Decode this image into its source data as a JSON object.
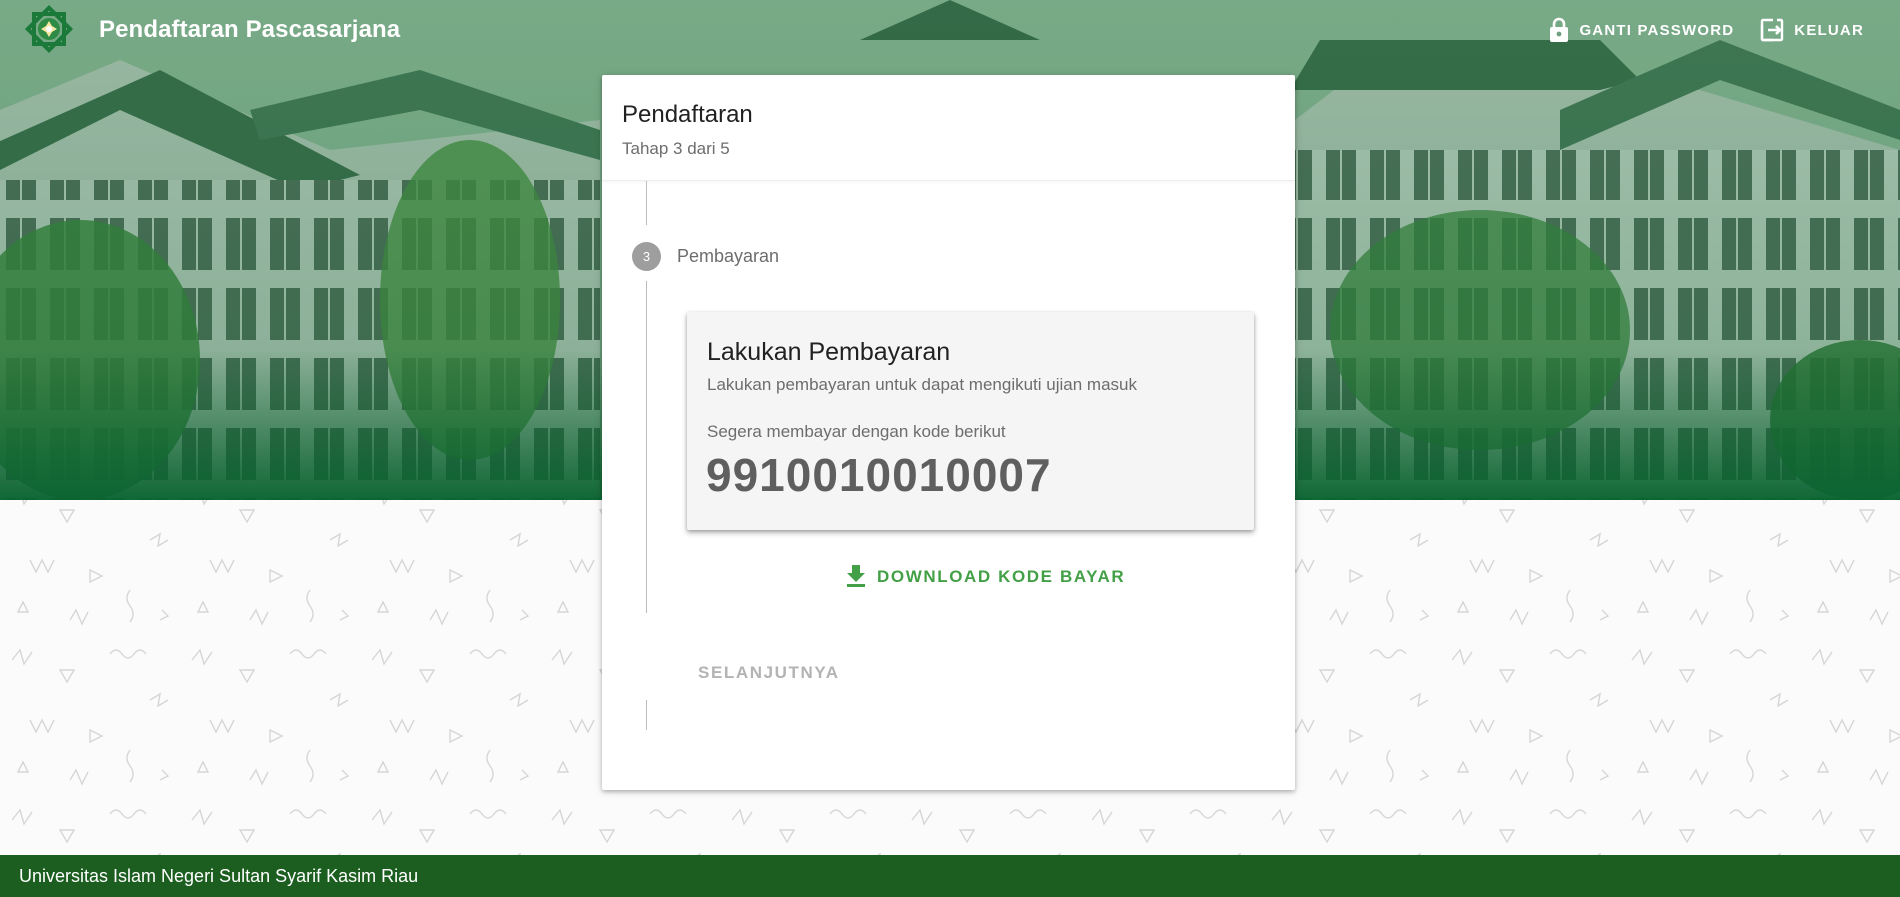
{
  "header": {
    "app_title": "Pendaftaran Pascasarjana",
    "logo_icon": "uin-suska-logo",
    "actions": [
      {
        "label": "GANTI PASSWORD",
        "icon": "lock-icon"
      },
      {
        "label": "KELUAR",
        "icon": "logout-icon"
      }
    ]
  },
  "card": {
    "title": "Pendaftaran",
    "subtitle": "Tahap 3 dari 5",
    "step": {
      "number": "3",
      "label": "Pembayaran"
    },
    "payment": {
      "title": "Lakukan Pembayaran",
      "description": "Lakukan pembayaran untuk dapat mengikuti ujian masuk",
      "hint": "Segera membayar dengan kode berikut",
      "code": "9910010010007"
    },
    "download_label": "DOWNLOAD KODE BAYAR",
    "next_label": "SELANJUTNYA"
  },
  "footer": {
    "text": "Universitas Islam Negeri Sultan Syarif Kasim Riau"
  },
  "colors": {
    "primary": "#1b5e20",
    "accent": "#43a047",
    "step_badge": "#9e9e9e"
  }
}
